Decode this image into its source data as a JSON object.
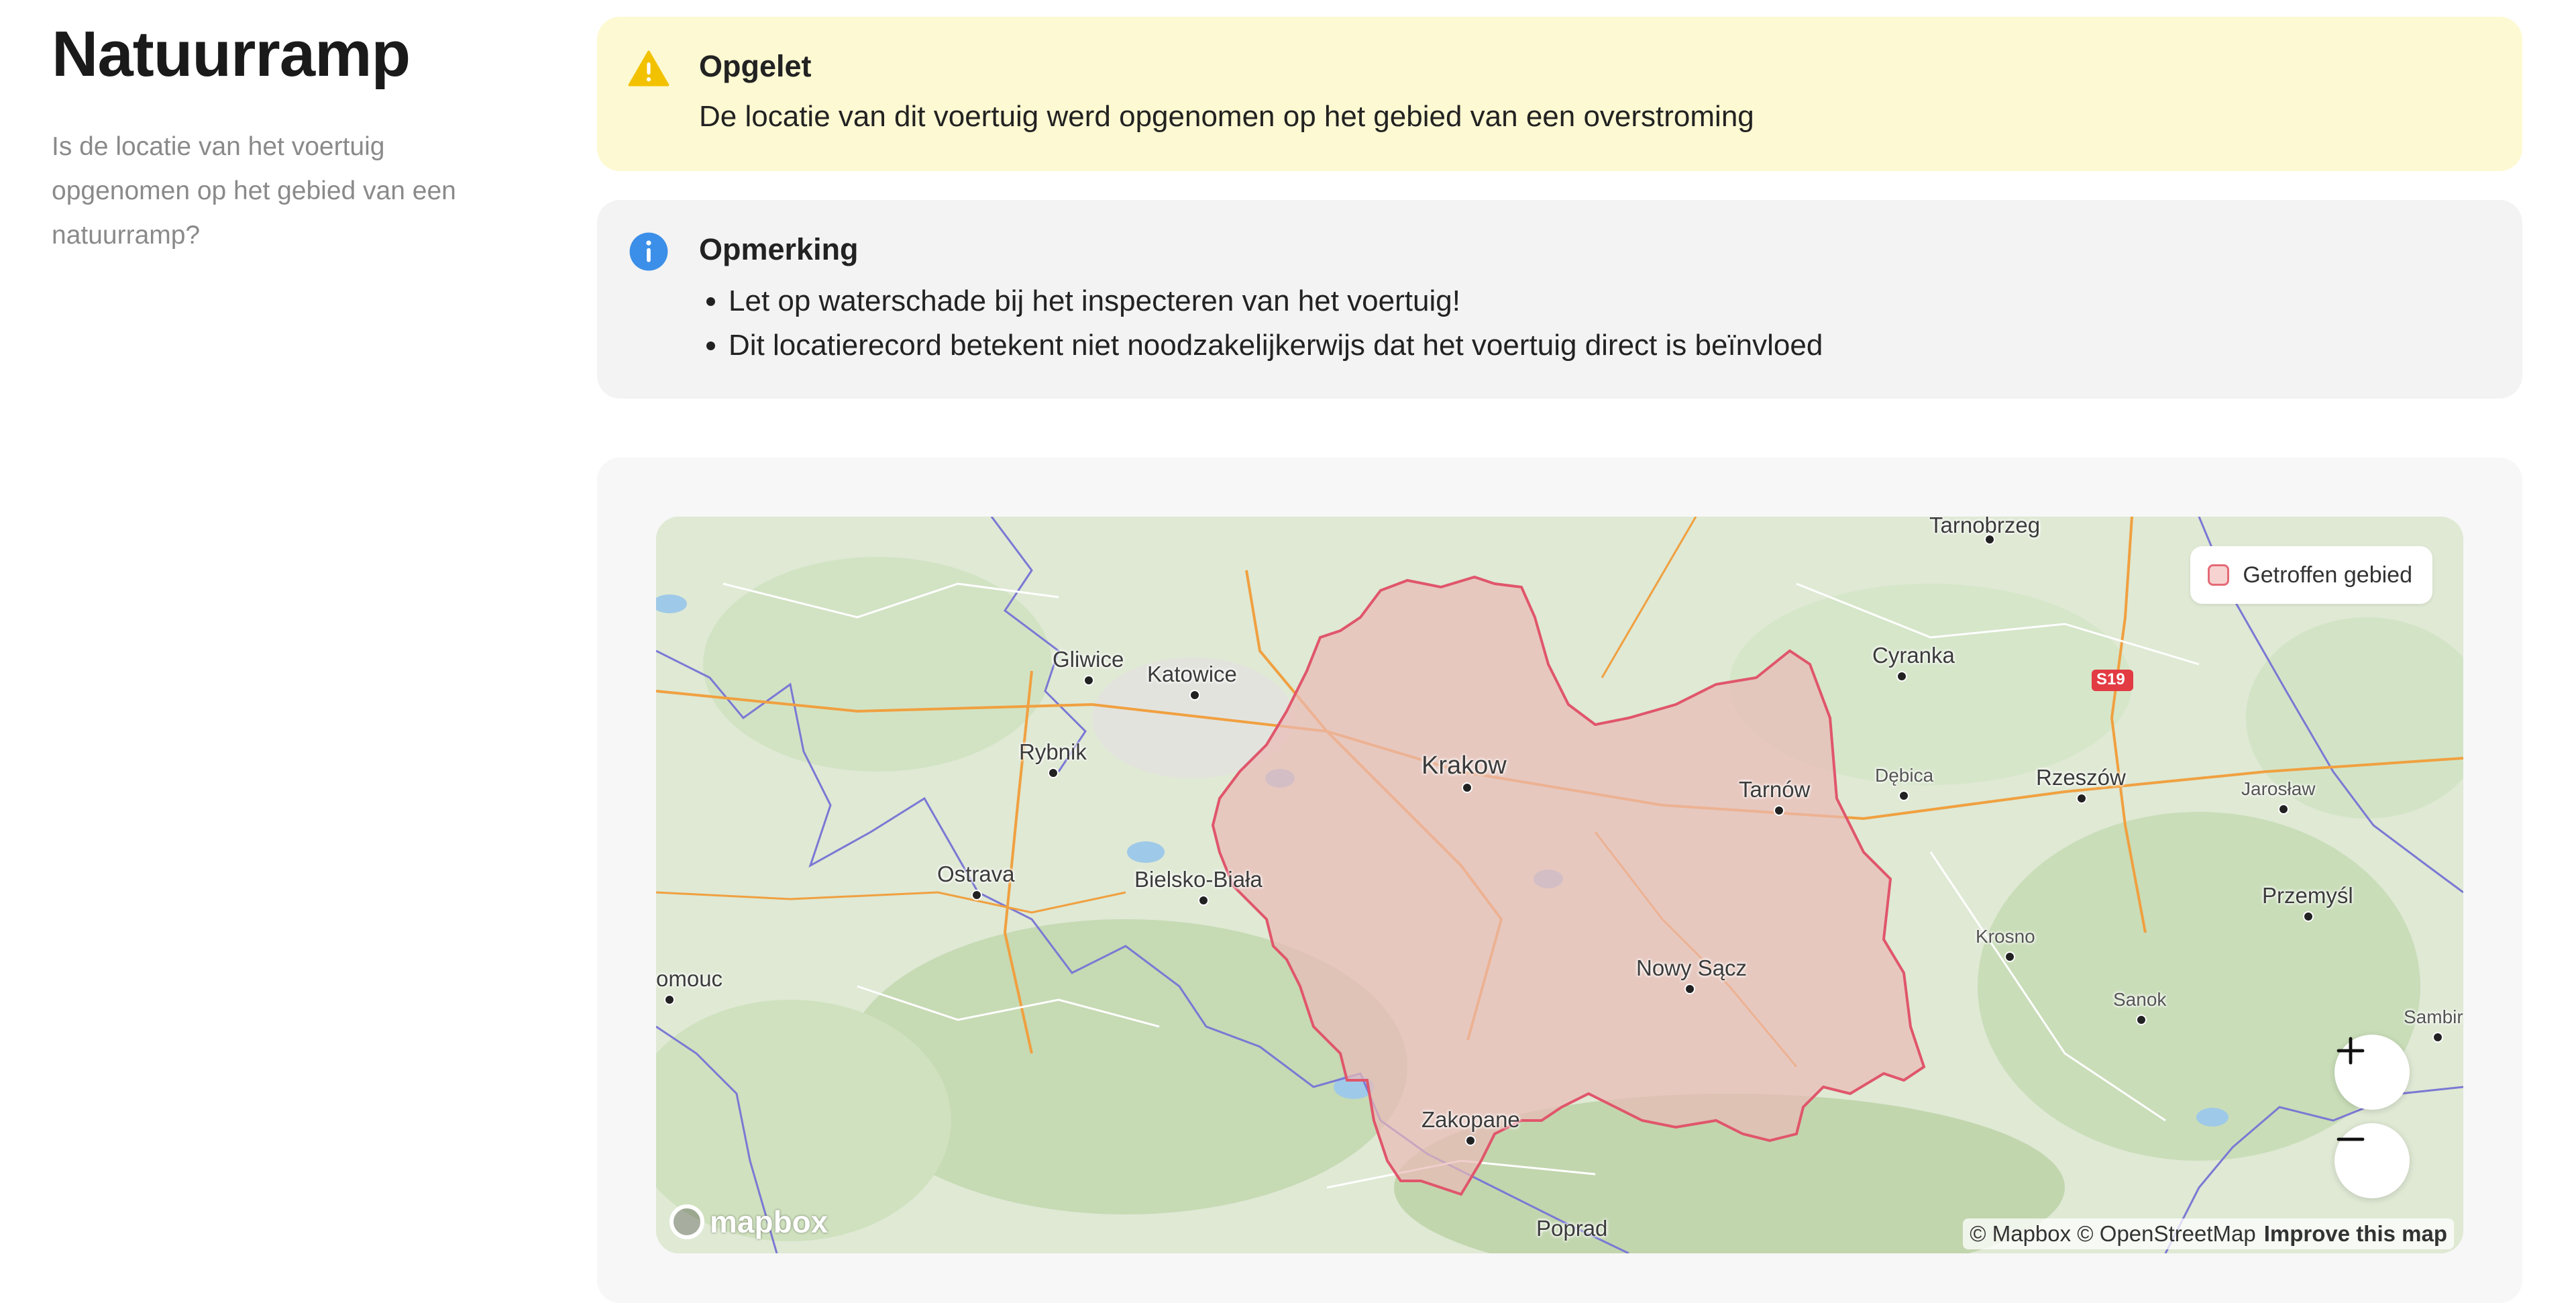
{
  "section": {
    "title": "Natuurramp",
    "description": "Is de locatie van het voertuig opgenomen op het gebied van een natuurramp?"
  },
  "warning": {
    "title": "Opgelet",
    "text": "De locatie van dit voertuig werd opgenomen op het gebied van een overstroming",
    "icon": "warning-triangle-icon",
    "color": "#fdf9d2",
    "icon_color": "#f2c200"
  },
  "note": {
    "title": "Opmerking",
    "items": [
      "Let op waterschade bij het inspecteren van het voertuig!",
      "Dit locatierecord betekent niet noodzakelijkerwijs dat het voertuig direct is beïnvloed"
    ],
    "icon": "info-circle-icon",
    "icon_color": "#3b8fe8"
  },
  "map": {
    "legend_label": "Getroffen gebied",
    "affected_fill": "#f6d3d1",
    "affected_stroke": "#e0566b",
    "cities": {
      "tarnobrzeg": "Tarnobrzeg",
      "gliwice": "Gliwice",
      "katowice": "Katowice",
      "cyranka": "Cyranka",
      "rybnik": "Rybnik",
      "krakow": "Krakow",
      "debica": "Dębica",
      "rzeszow": "Rzeszów",
      "tarnow": "Tarnów",
      "jaroslaw": "Jarosław",
      "ostrava": "Ostrava",
      "bielsko": "Bielsko-Biała",
      "przemysl": "Przemyśl",
      "krosno": "Krosno",
      "olomouc": "omouc",
      "nowy_sacz": "Nowy Sącz",
      "sanok": "Sanok",
      "sambir": "Sambir",
      "zakopane": "Zakopane",
      "poprad": "Poprad"
    },
    "road_badge": "S19",
    "zoom_in": "+",
    "zoom_out": "−",
    "logo": "mapbox",
    "attribution": "© Mapbox © OpenStreetMap",
    "improve": "Improve this map"
  }
}
